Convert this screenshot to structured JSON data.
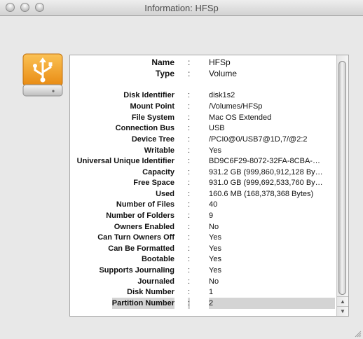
{
  "window": {
    "title": "Information: HFSp"
  },
  "icon": {
    "name": "usb-drive-icon",
    "color": "#f2a224"
  },
  "fields": [
    {
      "label": "Name",
      "value": "HFSp"
    },
    {
      "label": "Type",
      "value": "Volume"
    },
    {
      "label": "Disk Identifier",
      "value": "disk1s2"
    },
    {
      "label": "Mount Point",
      "value": "/Volumes/HFSp"
    },
    {
      "label": "File System",
      "value": "Mac OS Extended"
    },
    {
      "label": "Connection Bus",
      "value": "USB"
    },
    {
      "label": "Device Tree",
      "value": "/PCI0@0/USB7@1D,7/@2:2"
    },
    {
      "label": "Writable",
      "value": "Yes"
    },
    {
      "label": "Universal Unique Identifier",
      "value": "BD9C6F29-8072-32FA-8CBA-…"
    },
    {
      "label": "Capacity",
      "value": "931.2 GB (999,860,912,128 By…"
    },
    {
      "label": "Free Space",
      "value": "931.0 GB (999,692,533,760 By…"
    },
    {
      "label": "Used",
      "value": "160.6 MB (168,378,368 Bytes)"
    },
    {
      "label": "Number of Files",
      "value": "40"
    },
    {
      "label": "Number of Folders",
      "value": "9"
    },
    {
      "label": "Owners Enabled",
      "value": "No"
    },
    {
      "label": "Can Turn Owners Off",
      "value": "Yes"
    },
    {
      "label": "Can Be Formatted",
      "value": "Yes"
    },
    {
      "label": "Bootable",
      "value": "Yes"
    },
    {
      "label": "Supports Journaling",
      "value": "Yes"
    },
    {
      "label": "Journaled",
      "value": "No"
    },
    {
      "label": "Disk Number",
      "value": "1"
    },
    {
      "label": "Partition Number",
      "value": "2"
    }
  ],
  "colon": ":"
}
